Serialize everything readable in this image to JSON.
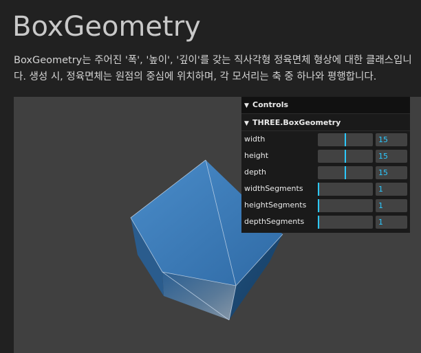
{
  "page": {
    "title": "BoxGeometry",
    "description": "BoxGeometry는 주어진 '폭', '높이', '깊이'를 갖는 직사각형 정육면체 형상에 대한 클래스입니다. 생성 시, 정육면체는 원점의 중심에 위치하며, 각 모서리는 축 중 하나와 평행합니다."
  },
  "scene": {
    "background": "#404040",
    "mesh_color": "#3a7bbd"
  },
  "gui": {
    "title": "Controls",
    "folder": "THREE.BoxGeometry",
    "rows": [
      {
        "label": "width",
        "value": "15",
        "fraction": 0.5
      },
      {
        "label": "height",
        "value": "15",
        "fraction": 0.5
      },
      {
        "label": "depth",
        "value": "15",
        "fraction": 0.5
      },
      {
        "label": "widthSegments",
        "value": "1",
        "fraction": 0.0
      },
      {
        "label": "heightSegments",
        "value": "1",
        "fraction": 0.0
      },
      {
        "label": "depthSegments",
        "value": "1",
        "fraction": 0.0
      }
    ],
    "accent": "#2cc9ff"
  }
}
